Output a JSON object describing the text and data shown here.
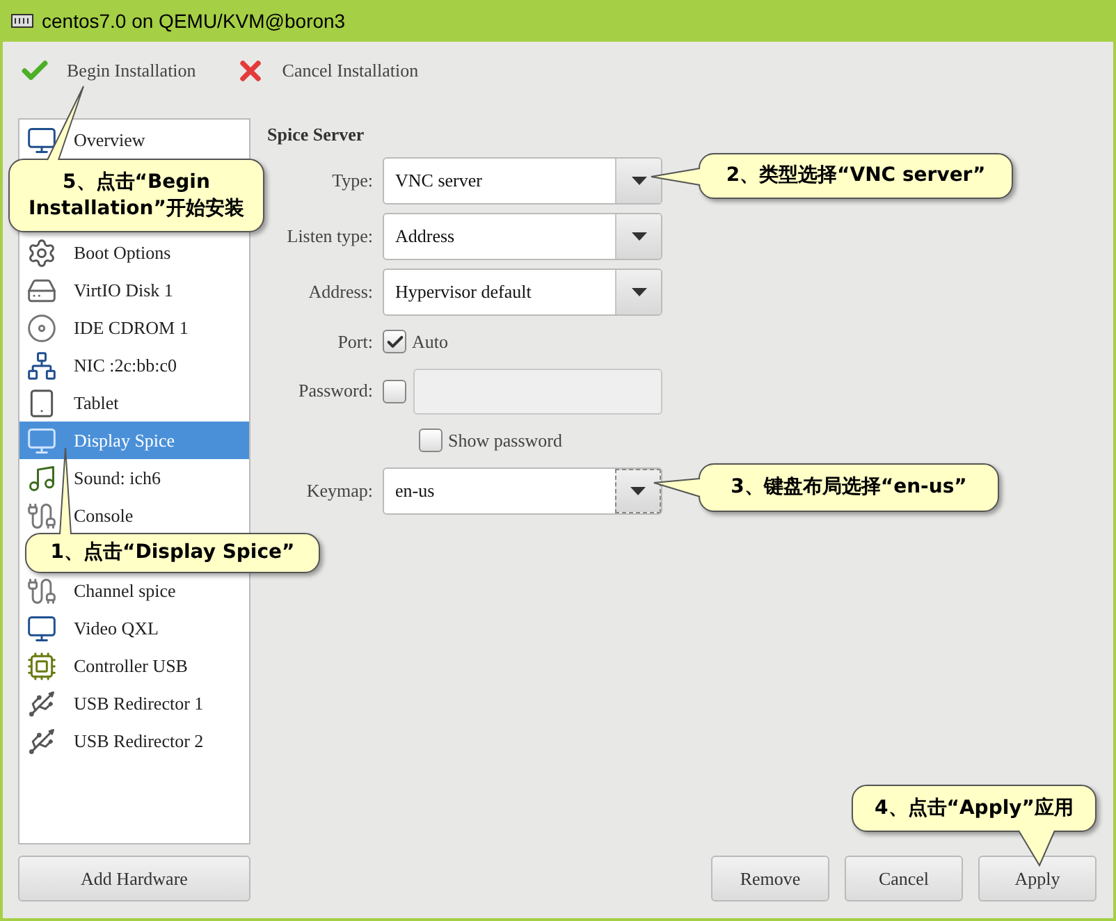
{
  "window": {
    "title": "centos7.0 on QEMU/KVM@boron3"
  },
  "toolbar": [
    {
      "kind": "begin",
      "label": "Begin Installation"
    },
    {
      "kind": "cancel",
      "label": "Cancel Installation"
    }
  ],
  "sidebar": {
    "items": [
      {
        "kind": "monitor",
        "label": "Overview",
        "selected": false
      },
      {
        "kind": "covered"
      },
      {
        "kind": "covered"
      },
      {
        "kind": "gears",
        "label": "Boot Options",
        "selected": false
      },
      {
        "kind": "disk",
        "label": "VirtIO Disk 1",
        "selected": false
      },
      {
        "kind": "cdrom",
        "label": "IDE CDROM 1",
        "selected": false
      },
      {
        "kind": "network",
        "label": "NIC :2c:bb:c0",
        "selected": false
      },
      {
        "kind": "tablet",
        "label": "Tablet",
        "selected": false
      },
      {
        "kind": "monitor",
        "label": "Display Spice",
        "selected": true
      },
      {
        "kind": "sound",
        "label": "Sound: ich6",
        "selected": false
      },
      {
        "kind": "serial",
        "label": "Console",
        "selected": false
      },
      {
        "kind": "covered"
      },
      {
        "kind": "serial",
        "label": "Channel spice",
        "selected": false
      },
      {
        "kind": "monitor",
        "label": "Video QXL",
        "selected": false
      },
      {
        "kind": "card",
        "label": "Controller USB",
        "selected": false
      },
      {
        "kind": "usb",
        "label": "USB Redirector 1",
        "selected": false
      },
      {
        "kind": "usb",
        "label": "USB Redirector 2",
        "selected": false
      }
    ],
    "add_button": "Add Hardware"
  },
  "panel": {
    "title": "Spice Server",
    "fields": [
      {
        "kind": "select",
        "label": "Type:",
        "value": "VNC server",
        "focused": false
      },
      {
        "kind": "select",
        "label": "Listen type:",
        "value": "Address",
        "focused": false
      },
      {
        "kind": "select",
        "label": "Address:",
        "value": "Hypervisor default",
        "focused": false
      },
      {
        "kind": "check",
        "label": "Port:",
        "option": "Auto",
        "checked": true
      },
      {
        "kind": "password",
        "label": "Password:",
        "checked": false,
        "disabled": true
      },
      {
        "kind": "option",
        "option": "Show password",
        "checked": false
      },
      {
        "kind": "select",
        "label": "Keymap:",
        "value": "en-us",
        "focused": true
      }
    ]
  },
  "buttons": [
    "Remove",
    "Cancel",
    "Apply"
  ],
  "callouts": [
    "1、点击“Display Spice”",
    "2、类型选择“VNC server”",
    "3、键盘布局选择“en-us”",
    "4、点击“Apply”应用",
    "5、点击“Begin Installation”开始安装"
  ]
}
